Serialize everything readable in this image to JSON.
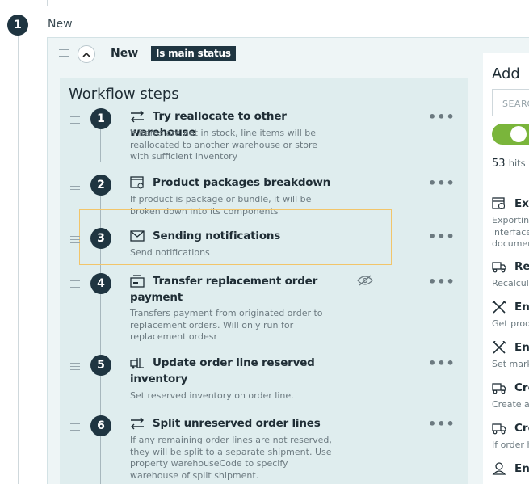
{
  "stage": {
    "number": "1",
    "label": "New"
  },
  "status": {
    "name": "New",
    "badge": "Is main status"
  },
  "workflow": {
    "title": "Workflow steps",
    "steps": [
      {
        "number": "1",
        "icon": "reallocate-icon",
        "title": "Try reallocate to other warehouse",
        "desc": "If items are not in stock, line items will be reallocated to another warehouse or store with sufficient inventory"
      },
      {
        "number": "2",
        "icon": "package-icon",
        "title": "Product packages breakdown",
        "desc": "If product is package or bundle, it will be broken down into its components"
      },
      {
        "number": "3",
        "icon": "envelope-icon",
        "title": "Sending notifications",
        "desc": "Send notifications"
      },
      {
        "number": "4",
        "icon": "payment-card-icon",
        "title": "Transfer replacement order payment",
        "desc": "Transfers payment from originated order to replacement orders. Will only run for replacement ordesr"
      },
      {
        "number": "5",
        "icon": "inventory-forklift-icon",
        "title": "Update order line reserved inventory",
        "desc": "Set reserved inventory on order line."
      },
      {
        "number": "6",
        "icon": "split-arrows-icon",
        "title": "Split unreserved order lines",
        "desc": "If any remaining order lines are not reserved, they will be split to a separate shipment. Use property warehouseCode to specify warehouse of split shipment."
      }
    ],
    "menu_glyph": "•••"
  },
  "add_panel": {
    "title": "Add",
    "search_placeholder": "SEARC",
    "hits_count": "53",
    "hits_label": "hits",
    "actions": [
      {
        "icon": "export-icon",
        "title": "Exp",
        "desc": "Exporting interface documen"
      },
      {
        "icon": "truck-icon",
        "title": "Rec",
        "desc": "Recalcul"
      },
      {
        "icon": "tools-icon",
        "title": "Enr",
        "desc": "Get prod"
      },
      {
        "icon": "tools-icon",
        "title": "Enr",
        "desc": "Set mark"
      },
      {
        "icon": "truck-icon",
        "title": "Cre",
        "desc": "Create a"
      },
      {
        "icon": "truck-icon",
        "title": "Cre",
        "desc": "If order h"
      },
      {
        "icon": "user-icon",
        "title": "Enr",
        "desc": ""
      }
    ]
  },
  "colors": {
    "dark_navy": "#1f3541",
    "panel_bg": "#dfedee",
    "card_bg": "#eef5f6",
    "toggle_green": "#7ab53b",
    "highlight": "#f2c56a"
  }
}
